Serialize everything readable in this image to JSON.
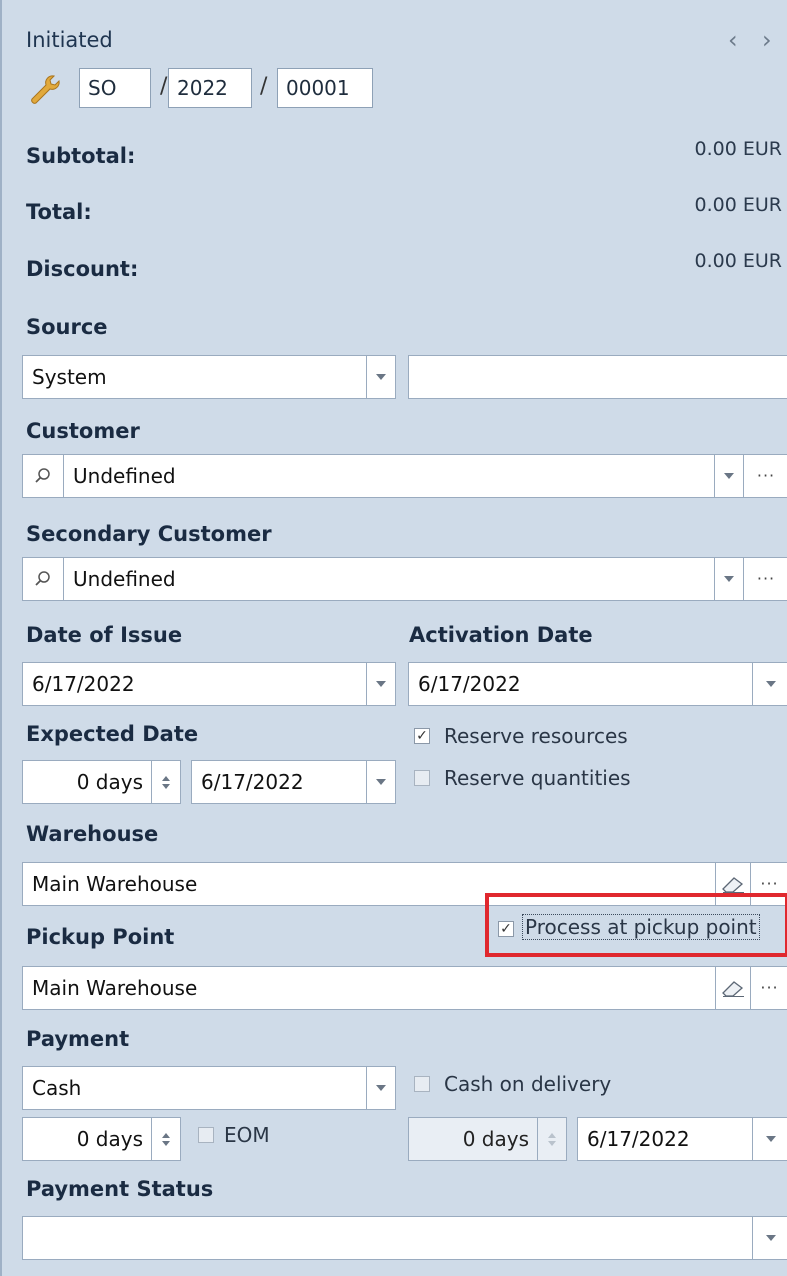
{
  "header": {
    "status": "Initiated",
    "nav_prev": "‹",
    "nav_next": "›",
    "number": {
      "prefix": "SO",
      "year": "2022",
      "seq": "00001",
      "separator": "/"
    }
  },
  "totals": {
    "subtotal_label": "Subtotal:",
    "subtotal_value": "0.00 EUR",
    "total_label": "Total:",
    "total_value": "0.00 EUR",
    "discount_label": "Discount:",
    "discount_value": "0.00 EUR"
  },
  "source": {
    "label": "Source",
    "value": "System",
    "extra_value": ""
  },
  "customer": {
    "label": "Customer",
    "value": "Undefined"
  },
  "secondary_customer": {
    "label": "Secondary Customer",
    "value": "Undefined"
  },
  "dates": {
    "issue_label": "Date of Issue",
    "issue_value": "6/17/2022",
    "activation_label": "Activation Date",
    "activation_value": "6/17/2022",
    "expected_label": "Expected Date",
    "expected_days": "0 days",
    "expected_value": "6/17/2022"
  },
  "reserve": {
    "resources_label": "Reserve resources",
    "resources_checked": true,
    "quantities_label": "Reserve quantities",
    "quantities_checked": false
  },
  "warehouse": {
    "label": "Warehouse",
    "value": "Main Warehouse"
  },
  "pickup": {
    "label": "Pickup Point",
    "value": "Main Warehouse",
    "process_label": "Process at pickup point",
    "process_checked": true
  },
  "payment": {
    "label": "Payment",
    "value": "Cash",
    "cod_label": "Cash on delivery",
    "cod_checked": false,
    "days": "0 days",
    "eom_label": "EOM",
    "eom_checked": false,
    "due_days": "0 days",
    "due_date": "6/17/2022"
  },
  "payment_status": {
    "label": "Payment Status",
    "value": ""
  },
  "icons": {
    "check": "✓",
    "ellipsis": "···"
  },
  "colors": {
    "panel_bg": "#cfdbe8",
    "highlight": "#e0282e",
    "wrench": "#e1a93c"
  }
}
